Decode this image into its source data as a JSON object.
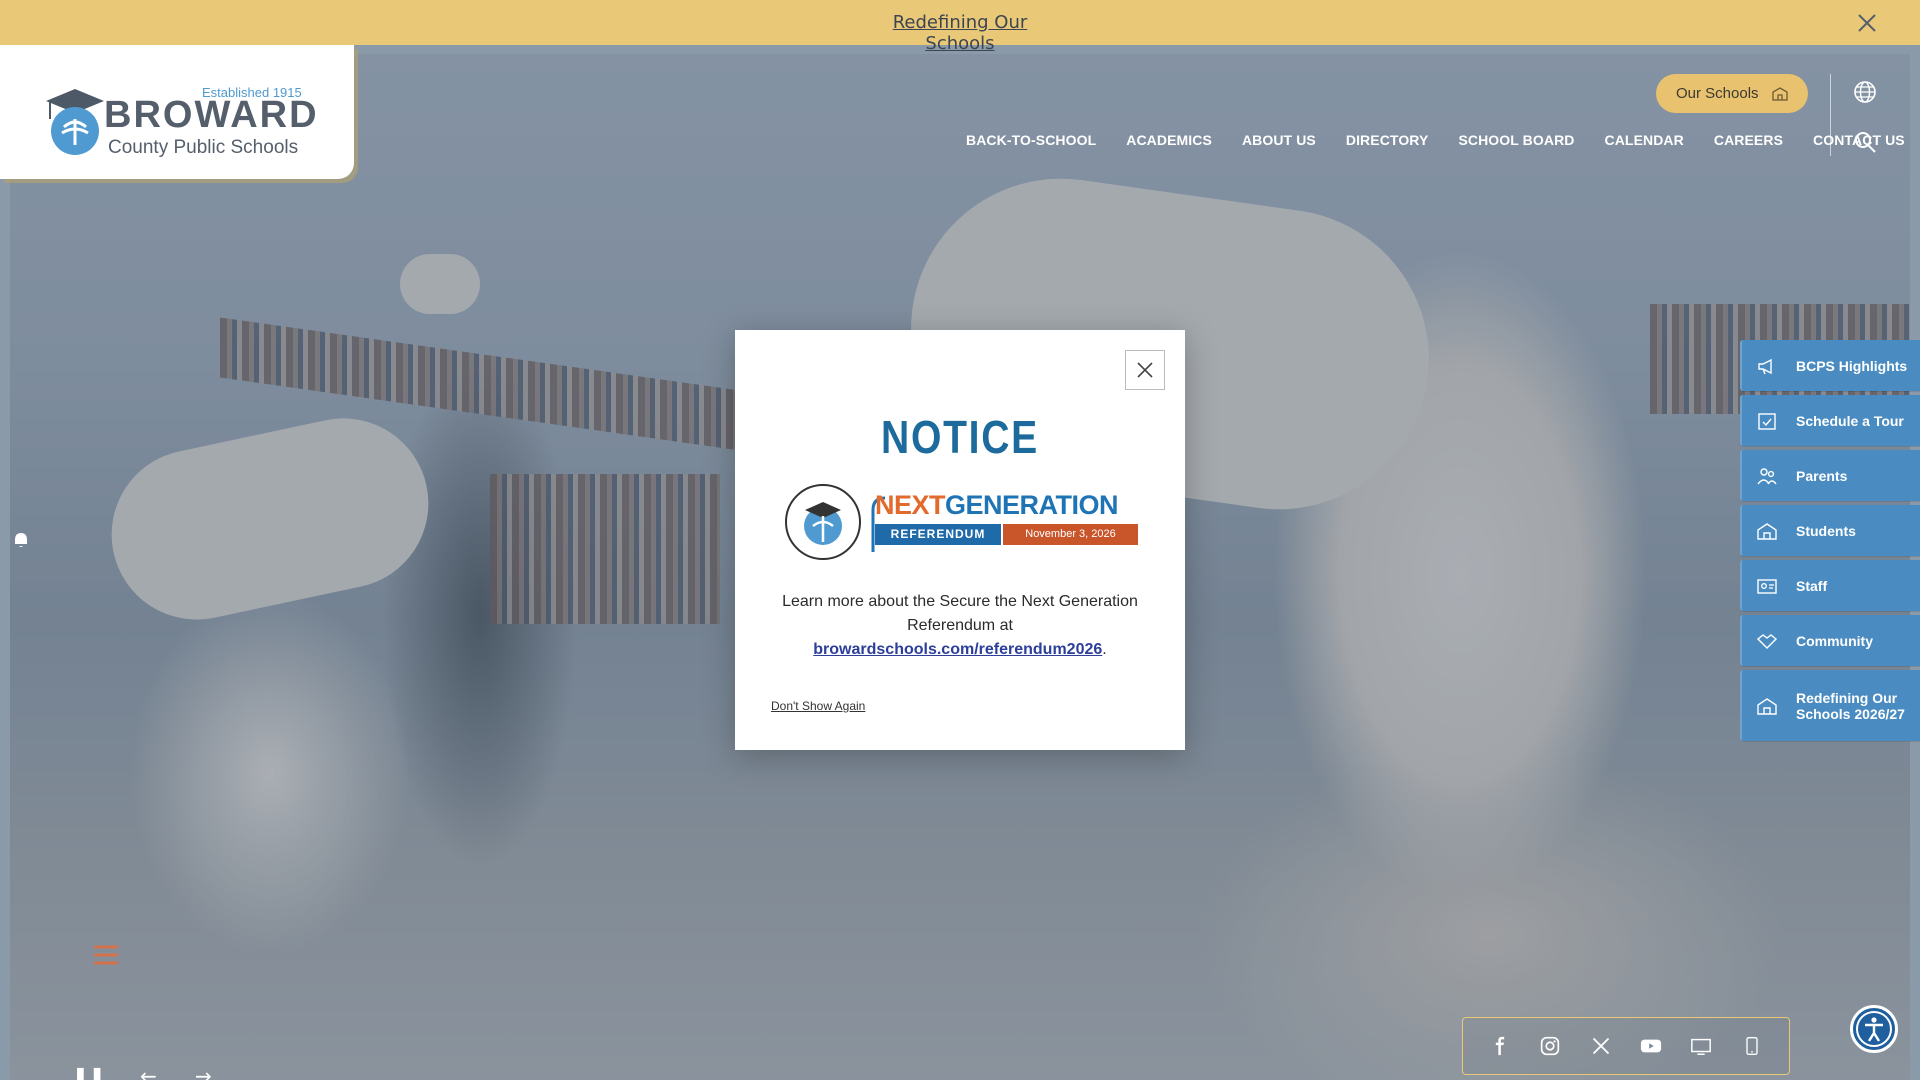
{
  "announcement": {
    "text": "Redefining Our Schools"
  },
  "logo": {
    "established": "Established 1915",
    "name": "BROWARD",
    "subtitle": "County Public Schools"
  },
  "header": {
    "our_schools_label": "Our Schools",
    "nav": [
      "BACK-TO-SCHOOL",
      "ACADEMICS",
      "ABOUT US",
      "DIRECTORY",
      "SCHOOL BOARD",
      "CALENDAR",
      "CAREERS",
      "CONTACT US"
    ]
  },
  "quick_links": [
    {
      "label": "BCPS Highlights",
      "icon": "megaphone-icon"
    },
    {
      "label": "Schedule a Tour",
      "icon": "calendar-check-icon"
    },
    {
      "label": "Parents",
      "icon": "parents-icon"
    },
    {
      "label": "Students",
      "icon": "school-building-icon"
    },
    {
      "label": "Staff",
      "icon": "id-card-icon"
    },
    {
      "label": "Community",
      "icon": "handshake-icon"
    },
    {
      "label": "Redefining Our Schools 2026/27",
      "icon": "school-building-icon"
    }
  ],
  "modal": {
    "title": "NOTICE",
    "logo_next": "NEXT",
    "logo_generation": "GENERATION",
    "logo_referendum": "REFERENDUM",
    "logo_date": "November 3, 2026",
    "message_prefix": "Learn more about the Secure the Next Generation Referendum at",
    "link_text": "browardschools.com/referendum2026",
    "message_suffix": ".",
    "dont_show": "Don't Show Again"
  },
  "social": [
    "facebook-icon",
    "instagram-icon",
    "x-icon",
    "youtube-icon",
    "tv-icon",
    "mobile-app-icon"
  ],
  "colors": {
    "gold": "#e9c878",
    "blue": "#4a8cc2",
    "brand_blue": "#1c6b9c",
    "orange": "#e26a2c"
  }
}
